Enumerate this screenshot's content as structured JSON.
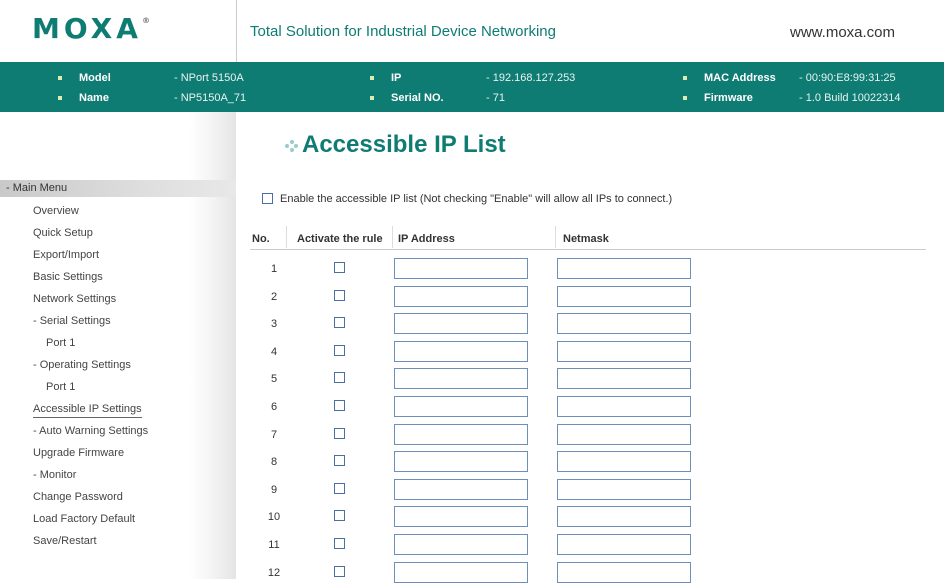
{
  "header": {
    "logo_text": "MOXA",
    "logo_mark": "®",
    "tagline": "Total Solution for Industrial Device Networking",
    "website": "www.moxa.com",
    "brand_color": "#0f7c73"
  },
  "info": {
    "model_label": "Model",
    "model_value": "- NPort 5150A",
    "name_label": "Name",
    "name_value": "- NP5150A_71",
    "ip_label": "IP",
    "ip_value": "- 192.168.127.253",
    "serial_label": "Serial NO.",
    "serial_value": "- 71",
    "mac_label": "MAC Address",
    "mac_value": "- 00:90:E8:99:31:25",
    "firmware_label": "Firmware",
    "firmware_value": "- 1.0 Build 10022314"
  },
  "menu": {
    "header": "- Main Menu",
    "items": [
      "Overview",
      "Quick Setup",
      "Export/Import",
      "Basic Settings",
      "Network Settings",
      "- Serial Settings",
      "Port 1",
      "- Operating Settings",
      "Port 1",
      "Accessible IP Settings",
      "- Auto Warning Settings",
      "Upgrade Firmware",
      "- Monitor",
      "Change Password",
      "Load Factory Default",
      "Save/Restart"
    ],
    "active_index": 9
  },
  "page": {
    "title": "Accessible IP List",
    "enable_label": "Enable the accessible IP list (Not checking \"Enable\" will allow all IPs to connect.)",
    "enable_checked": false
  },
  "table": {
    "headers": {
      "no": "No.",
      "activate": "Activate the rule",
      "ip": "IP Address",
      "netmask": "Netmask"
    },
    "rows": [
      {
        "no": "1",
        "active": false,
        "ip": "",
        "netmask": ""
      },
      {
        "no": "2",
        "active": false,
        "ip": "",
        "netmask": ""
      },
      {
        "no": "3",
        "active": false,
        "ip": "",
        "netmask": ""
      },
      {
        "no": "4",
        "active": false,
        "ip": "",
        "netmask": ""
      },
      {
        "no": "5",
        "active": false,
        "ip": "",
        "netmask": ""
      },
      {
        "no": "6",
        "active": false,
        "ip": "",
        "netmask": ""
      },
      {
        "no": "7",
        "active": false,
        "ip": "",
        "netmask": ""
      },
      {
        "no": "8",
        "active": false,
        "ip": "",
        "netmask": ""
      },
      {
        "no": "9",
        "active": false,
        "ip": "",
        "netmask": ""
      },
      {
        "no": "10",
        "active": false,
        "ip": "",
        "netmask": ""
      },
      {
        "no": "11",
        "active": false,
        "ip": "",
        "netmask": ""
      },
      {
        "no": "12",
        "active": false,
        "ip": "",
        "netmask": ""
      }
    ]
  }
}
